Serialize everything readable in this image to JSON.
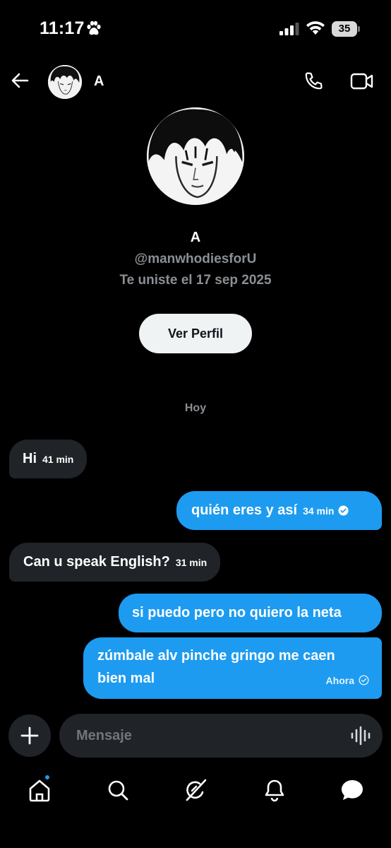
{
  "status_bar": {
    "time": "11:17",
    "battery": "35"
  },
  "header": {
    "name": "A"
  },
  "profile": {
    "name": "A",
    "handle": "@manwhodiesforU",
    "joined": "Te uniste el 17 sep 2025",
    "button_label": "Ver Perfil"
  },
  "date_separator": "Hoy",
  "messages": [
    {
      "direction": "received",
      "text": "Hi",
      "time": "41 min"
    },
    {
      "direction": "sent",
      "text": "quién eres y así",
      "time": "34 min"
    },
    {
      "direction": "received",
      "text": "Can u speak English?",
      "time": "31 min"
    },
    {
      "direction": "sent",
      "text": "si puedo pero no quiero la neta",
      "time": ""
    },
    {
      "direction": "sent",
      "text_line1": "zúmbale alv pinche gringo me caen",
      "text_line2": "bien mal",
      "time": "Ahora"
    }
  ],
  "composer": {
    "placeholder": "Mensaje"
  },
  "tabs": [
    "home-icon",
    "search-icon",
    "grok-icon",
    "notifications-icon",
    "messages-icon"
  ],
  "colors": {
    "accent": "#1d9bf0",
    "received_bubble": "#202327",
    "background": "#000000",
    "muted": "#8b8f94"
  }
}
